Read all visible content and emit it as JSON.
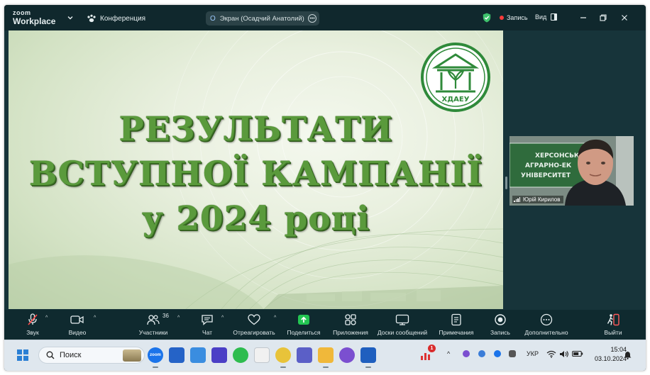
{
  "window": {
    "logo_top": "zoom",
    "logo_bottom": "Workplace",
    "meeting_label": "Конференция",
    "share_indicator": "Экран (Осадчий Анатолий)",
    "share_indicator_prefix": "O",
    "recording_label": "Запись",
    "view_label": "Вид",
    "accent_green": "#3ec16c",
    "record_red": "#ff3b3b"
  },
  "slide": {
    "title_lines": [
      "РЕЗУЛЬТАТИ",
      "ВСТУПНОЇ КАМПАНІЇ",
      "у 2024 році"
    ],
    "emblem_text": "ХДАЕУ",
    "title_color": "#5a9a3c"
  },
  "video_tile": {
    "background_text_lines": [
      "ХЕРСОНСЬКИЙ",
      "АГРАРНО-ЕК",
      "УНІВЕРСИТЕТ"
    ],
    "participant_name": "Юрій Кирилов"
  },
  "toolbar": {
    "items": [
      {
        "label": "Звук",
        "icon": "microphone-muted-icon"
      },
      {
        "label": "Видео",
        "icon": "video-camera-icon"
      },
      {
        "label": "Участники",
        "icon": "participants-icon",
        "count": "36"
      },
      {
        "label": "Чат",
        "icon": "chat-icon"
      },
      {
        "label": "Отреагировать",
        "icon": "heart-icon"
      },
      {
        "label": "Поделиться",
        "icon": "share-screen-icon"
      },
      {
        "label": "Приложения",
        "icon": "apps-icon"
      },
      {
        "label": "Доски сообщений",
        "icon": "whiteboard-icon"
      },
      {
        "label": "Примечания",
        "icon": "notes-icon"
      },
      {
        "label": "Запись",
        "icon": "record-icon"
      },
      {
        "label": "Дополнительно",
        "icon": "more-icon"
      },
      {
        "label": "Выйти",
        "icon": "leave-icon"
      }
    ],
    "share_green": "#23c552"
  },
  "taskbar": {
    "search_placeholder": "Поиск",
    "zoom_app_label": "zoom",
    "notification_badge": "1",
    "language": "УКР",
    "time": "15:04",
    "date": "03.10.2024"
  }
}
